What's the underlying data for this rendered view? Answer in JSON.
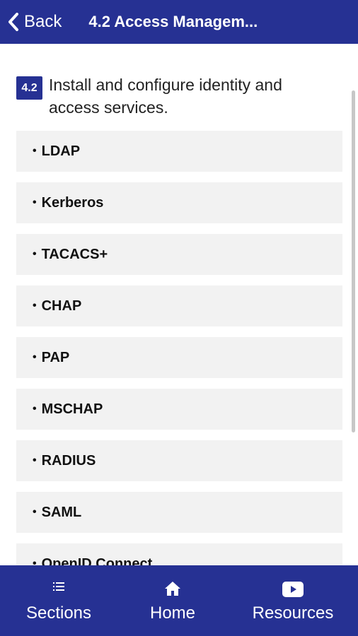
{
  "header": {
    "back_label": "Back",
    "title": "4.2 Access Managem..."
  },
  "objective": {
    "badge": "4.2",
    "text": "Install and configure identity and access services."
  },
  "items": [
    {
      "label": "LDAP"
    },
    {
      "label": "Kerberos"
    },
    {
      "label": "TACACS+"
    },
    {
      "label": "CHAP"
    },
    {
      "label": "PAP"
    },
    {
      "label": "MSCHAP"
    },
    {
      "label": "RADIUS"
    },
    {
      "label": "SAML"
    },
    {
      "label": "OpenID Connect"
    }
  ],
  "bullet": "•",
  "bottom_nav": [
    {
      "label": "Sections",
      "icon": "list-icon"
    },
    {
      "label": "Home",
      "icon": "home-icon"
    },
    {
      "label": "Resources",
      "icon": "play-icon"
    }
  ],
  "colors": {
    "brand": "#263193",
    "item_bg": "#f2f2f2"
  }
}
